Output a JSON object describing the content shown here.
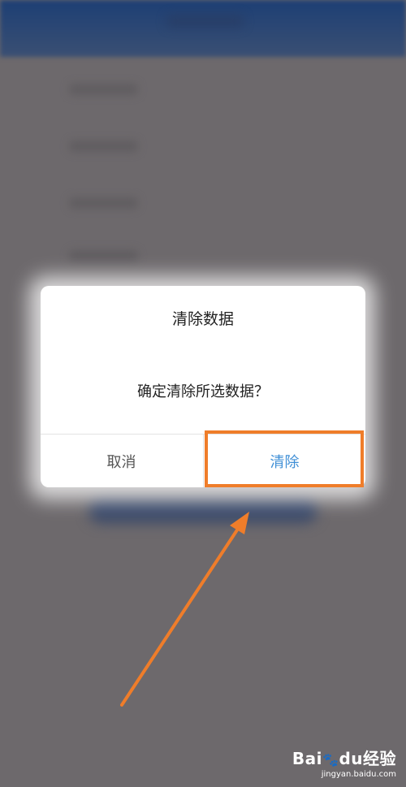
{
  "dialog": {
    "title": "清除数据",
    "message": "确定清除所选数据？",
    "cancel_label": "取消",
    "confirm_label": "清除"
  },
  "colors": {
    "confirm_text": "#3f8fd6",
    "highlight": "#ef7d2a",
    "overlay": "#6d696c"
  },
  "watermark": {
    "logo_left": "Bai",
    "logo_paw": "du",
    "logo_right": "经验",
    "url": "jingyan.baidu.com"
  }
}
